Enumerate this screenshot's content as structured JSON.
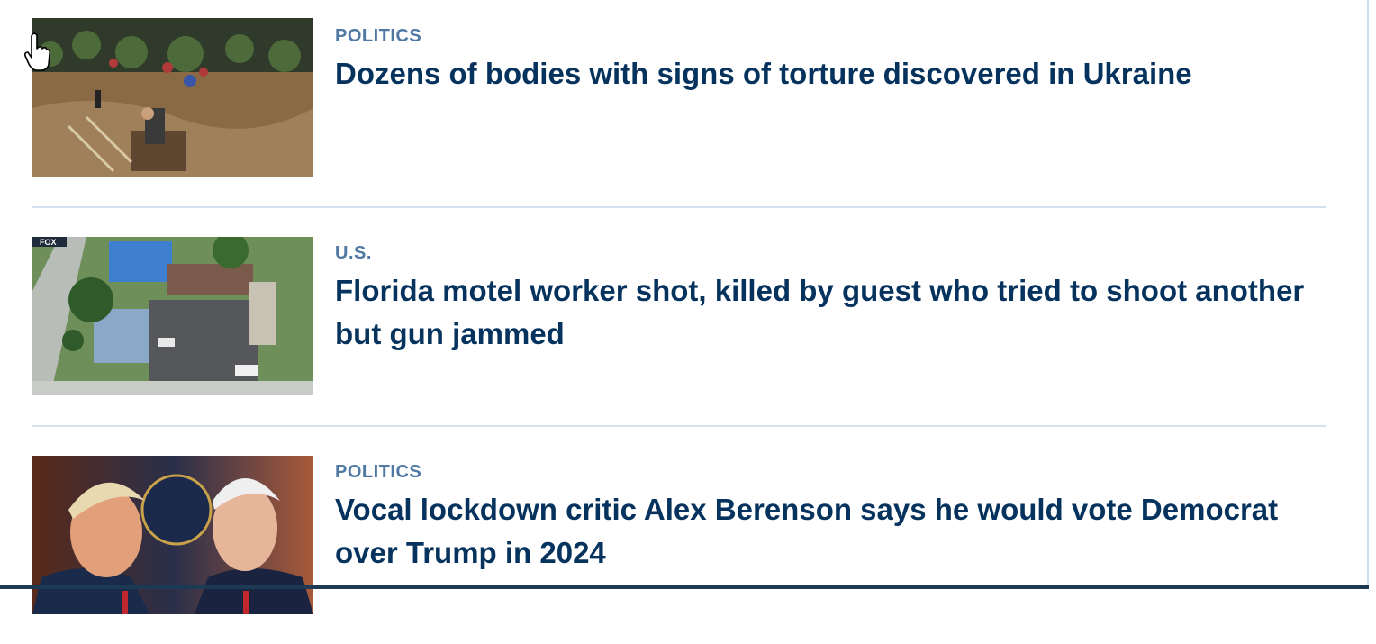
{
  "articles": [
    {
      "category": "POLITICS",
      "headline": "Dozens of bodies with signs of torture discovered in Ukraine",
      "image": "cemetery-photo"
    },
    {
      "category": "U.S.",
      "headline": "Florida motel worker shot, killed by guest who tried to shoot another but gun jammed",
      "image": "aerial-motel-photo",
      "image_badge": "FOX"
    },
    {
      "category": "POLITICS",
      "headline": "Vocal lockdown critic Alex Berenson says he would vote Democrat over Trump in 2024",
      "image": "two-politicians-photo"
    }
  ],
  "colors": {
    "kicker": "#4f78a3",
    "headline": "#06335e",
    "divider": "#d3e2ee"
  },
  "icons": {
    "cursor": "hand-pointer-icon"
  }
}
